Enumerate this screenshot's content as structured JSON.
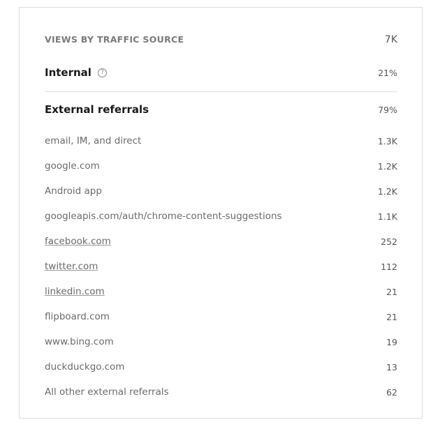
{
  "header": {
    "title": "VIEWS BY TRAFFIC SOURCE",
    "total": "7K"
  },
  "internal": {
    "label": "Internal",
    "help_icon": "question-circle-icon",
    "percent": "21%"
  },
  "external": {
    "label": "External referrals",
    "percent": "79%"
  },
  "referrals": [
    {
      "name": "email, IM, and direct",
      "value": "1.3K",
      "link": false
    },
    {
      "name": "google.com",
      "value": "1.2K",
      "link": false
    },
    {
      "name": "Android app",
      "value": "1.2K",
      "link": false
    },
    {
      "name": "googleapis.com/auth/chrome-content-suggestions",
      "value": "1.1K",
      "link": false
    },
    {
      "name": "facebook.com",
      "value": "252",
      "link": true
    },
    {
      "name": "twitter.com",
      "value": "112",
      "link": true
    },
    {
      "name": "linkedin.com",
      "value": "21",
      "link": true
    },
    {
      "name": "flipboard.com",
      "value": "21",
      "link": false
    },
    {
      "name": "www.bing.com",
      "value": "19",
      "link": false
    },
    {
      "name": "duckduckgo.com",
      "value": "13",
      "link": false
    },
    {
      "name": "All other external referrals",
      "value": "62",
      "link": false
    }
  ]
}
